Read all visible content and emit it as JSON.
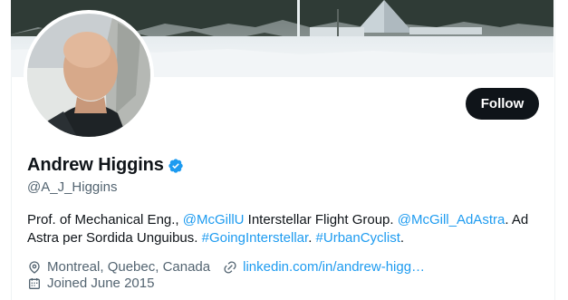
{
  "profile": {
    "name": "Andrew Higgins",
    "handle": "@A_J_Higgins",
    "follow_label": "Follow",
    "verified_icon": "verified-badge-icon",
    "accent_color": "#1d9bf0"
  },
  "bio": {
    "t1": "Prof. of Mechanical Eng., ",
    "m1": "@McGillU",
    "t2": " Interstellar Flight Group. ",
    "m2": "@McGill_AdAstra",
    "t3": ". Ad Astra per Sordida Unguibus. ",
    "h1": "#GoingInterstellar",
    "t4": ". ",
    "h2": "#UrbanCyclist",
    "t5": "."
  },
  "meta": {
    "location": "Montreal, Quebec, Canada",
    "website": "linkedin.com/in/andrew-higg…",
    "joined": "Joined June 2015"
  }
}
